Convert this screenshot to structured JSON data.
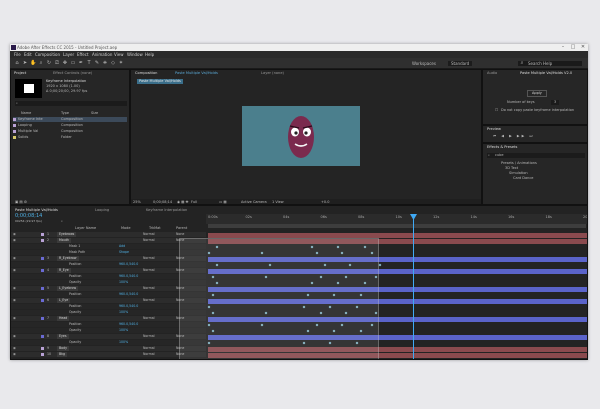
{
  "titlebar": {
    "title": "Adobe After Effects CC 2015 - Untitled Project.aep",
    "minimize": "–",
    "maximize": "□",
    "close": "✕"
  },
  "menu": [
    "File",
    "Edit",
    "Composition",
    "Layer",
    "Effect",
    "Animation",
    "View",
    "Window",
    "Help"
  ],
  "toolbar": {
    "workspace_label": "Workspaces",
    "workspace_value": "Standard",
    "search_placeholder": "Search Help"
  },
  "project": {
    "tab": "Project",
    "effect_controls_tab": "Effect Controls (none)",
    "selected_name": "Keyframe Interpolation",
    "selected_info": "1920 x 1080 (1.00)",
    "selected_info2": "Δ 0;00;20;00, 29.97 fps",
    "columns": {
      "name": "Name",
      "type": "Type",
      "size": "Size"
    },
    "items": [
      {
        "name": "Keyframe Inte",
        "type": "Composition",
        "color": "#b9a2d6"
      },
      {
        "name": "Looping",
        "type": "Composition",
        "color": "#b9a2d6"
      },
      {
        "name": "Multiple Val",
        "type": "Composition",
        "color": "#b9a2d6"
      },
      {
        "name": "Solids",
        "type": "Folder",
        "color": "#d7c96b"
      }
    ]
  },
  "comp_panel": {
    "tab": "Composition",
    "tab_detail": "Paste Multiple Val/Holds",
    "layer_tab": "Layer (none)",
    "comp_label": "Paste Multiple Val/Holds",
    "zoom": "25%",
    "timecode": "0;00;08;14",
    "quality": "Full",
    "camera": "Active Camera",
    "views": "1 View",
    "exposure": "+0.0",
    "character_color": "#7b2a4e",
    "bg_color": "#4b7f8d"
  },
  "info_panel": {
    "tabs": [
      "Audio",
      "Paste Multiple Val/Holds V2.0"
    ],
    "apply_label": "Apply",
    "number_label": "Number of keys",
    "number_value": "3",
    "note": "Do not copy paste keyframe interpolation"
  },
  "preview_panel": {
    "tab": "Preview"
  },
  "effects_panel": {
    "tab": "Effects & Presets",
    "search_placeholder": "cube",
    "items": [
      "Presets / Animations",
      "3D Text",
      "Simulation",
      "Card Dance"
    ]
  },
  "timeline": {
    "tabs": [
      "Paste Multiple Val/Holds",
      "Looping",
      "Keyframe Interpolation"
    ],
    "timecode": "0;00;08;14",
    "timecode_sub": "00254 (29.97 fps)",
    "columns": {
      "layer_name": "Layer Name",
      "mode": "Mode",
      "trkmat": "TrkMat",
      "parent": "Parent"
    },
    "ruler": [
      "0:00s",
      "02s",
      "04s",
      "06s",
      "08s",
      "10s",
      "12s",
      "14s",
      "16s",
      "18s",
      "20s"
    ],
    "layers": [
      {
        "num": "1",
        "name": "Eyebrows",
        "value": "",
        "color": "#b9a2d6",
        "track": "#8a4a4e"
      },
      {
        "num": "2",
        "name": "Mouth",
        "value": "",
        "color": "#b9a2d6",
        "track": "#8a4a4e"
      },
      {
        "num": "",
        "name": "Mask 1",
        "value": "Add",
        "color": "",
        "track": ""
      },
      {
        "num": "",
        "name": "Mask Path",
        "value": "Shape",
        "color": "",
        "track": ""
      },
      {
        "num": "3",
        "name": "R_Eyebrow",
        "value": "",
        "color": "#6a6ad3",
        "track": "#5a63c9"
      },
      {
        "num": "",
        "name": "Position",
        "value": "960.0,540.0",
        "color": "",
        "track": ""
      },
      {
        "num": "4",
        "name": "R_Eye",
        "value": "",
        "color": "#6a6ad3",
        "track": "#5a63c9"
      },
      {
        "num": "",
        "name": "Position",
        "value": "960.0,540.0",
        "color": "",
        "track": ""
      },
      {
        "num": "",
        "name": "Opacity",
        "value": "100%",
        "color": "",
        "track": ""
      },
      {
        "num": "5",
        "name": "L_Eyebrow",
        "value": "",
        "color": "#6a6ad3",
        "track": "#5a63c9"
      },
      {
        "num": "",
        "name": "Position",
        "value": "960.0,540.0",
        "color": "",
        "track": ""
      },
      {
        "num": "6",
        "name": "L_Eye",
        "value": "",
        "color": "#6a6ad3",
        "track": "#5a63c9"
      },
      {
        "num": "",
        "name": "Position",
        "value": "960.0,540.0",
        "color": "",
        "track": ""
      },
      {
        "num": "",
        "name": "Opacity",
        "value": "100%",
        "color": "",
        "track": ""
      },
      {
        "num": "7",
        "name": "Head",
        "value": "",
        "color": "#6a6ad3",
        "track": "#5a63c9"
      },
      {
        "num": "",
        "name": "Position",
        "value": "960.0,540.0",
        "color": "",
        "track": ""
      },
      {
        "num": "",
        "name": "Opacity",
        "value": "100%",
        "color": "",
        "track": ""
      },
      {
        "num": "8",
        "name": "Eyes",
        "value": "",
        "color": "#6a6ad3",
        "track": "#5a63c9"
      },
      {
        "num": "",
        "name": "Opacity",
        "value": "100%",
        "color": "",
        "track": ""
      },
      {
        "num": "9",
        "name": "Body",
        "value": "",
        "color": "#b9a2d6",
        "track": "#8a4a4e"
      },
      {
        "num": "10",
        "name": "Bkg",
        "value": "",
        "color": "#b9a2d6",
        "track": "#8a4a4e"
      }
    ],
    "mode_value": "Normal",
    "parent_value": "None",
    "accent": "#2aa6d6",
    "playhead_color": "#3fa9f5"
  }
}
